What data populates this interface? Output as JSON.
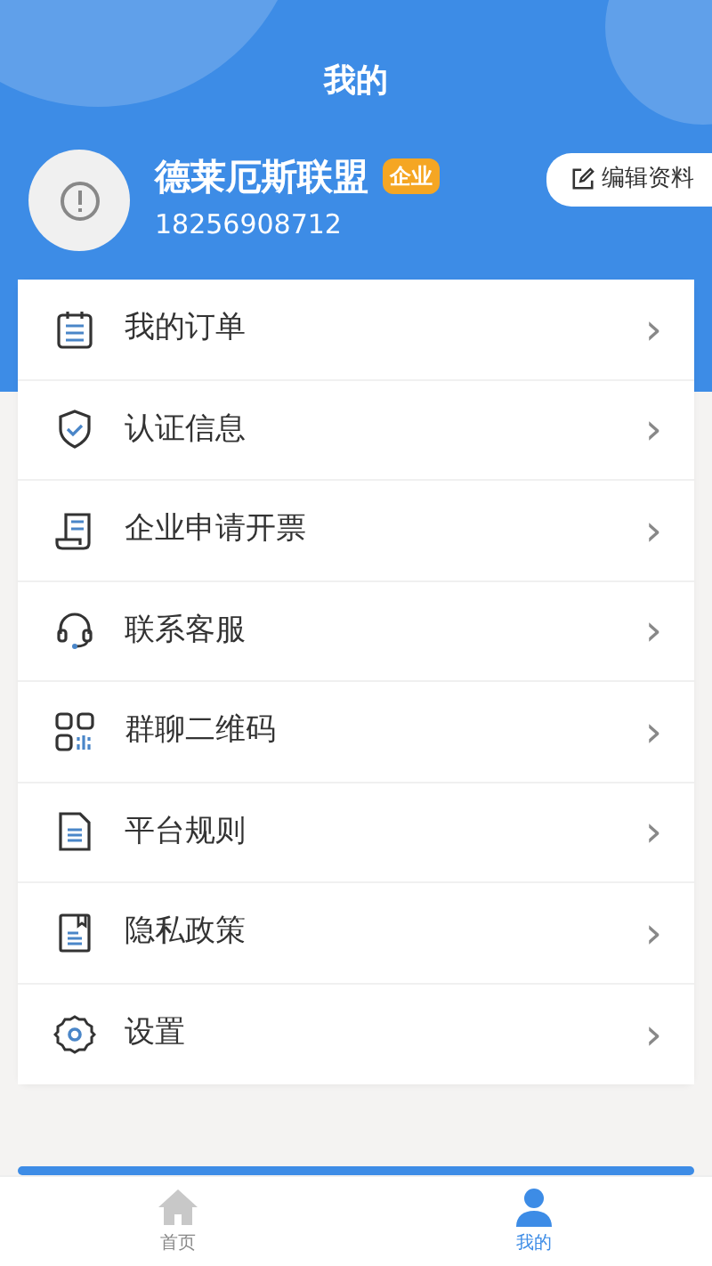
{
  "header": {
    "title": "我的"
  },
  "profile": {
    "name": "德莱厄斯联盟",
    "badge": "企业",
    "phone": "18256908712",
    "edit_button": "编辑资料"
  },
  "menu": [
    {
      "label": "我的订单",
      "chevron": "›"
    },
    {
      "label": "认证信息",
      "chevron": "›"
    },
    {
      "label": "企业申请开票",
      "chevron": "›"
    },
    {
      "label": "联系客服",
      "chevron": "›"
    },
    {
      "label": "群聊二维码",
      "chevron": "›"
    },
    {
      "label": "平台规则",
      "chevron": "›"
    },
    {
      "label": "隐私政策",
      "chevron": "›"
    },
    {
      "label": "设置",
      "chevron": "›"
    }
  ],
  "tab_bar": [
    {
      "label": "首页",
      "selected": false
    },
    {
      "label": "我的",
      "selected": true
    }
  ]
}
